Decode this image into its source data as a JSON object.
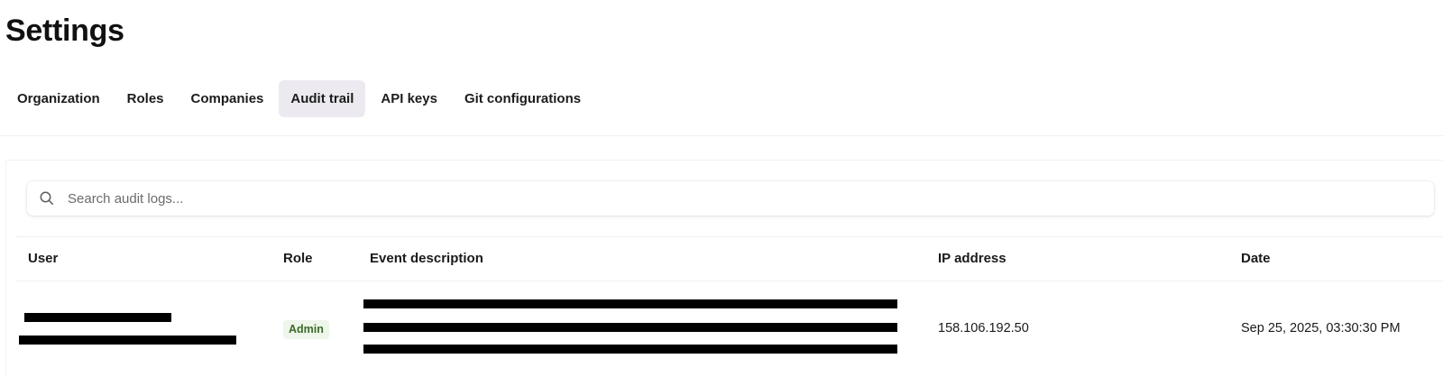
{
  "page": {
    "title": "Settings"
  },
  "tabs": [
    {
      "label": "Organization",
      "active": false
    },
    {
      "label": "Roles",
      "active": false
    },
    {
      "label": "Companies",
      "active": false
    },
    {
      "label": "Audit trail",
      "active": true
    },
    {
      "label": "API keys",
      "active": false
    },
    {
      "label": "Git configurations",
      "active": false
    }
  ],
  "search": {
    "placeholder": "Search audit logs...",
    "value": "",
    "icon": "search-icon"
  },
  "table": {
    "columns": [
      "User",
      "Role",
      "Event description",
      "IP address",
      "Date"
    ],
    "rows": [
      {
        "user": "[redacted]",
        "role": "Admin",
        "event_description": "[redacted]",
        "ip_address": "158.106.192.50",
        "date": "Sep 25, 2025, 03:30:30 PM"
      }
    ]
  },
  "colors": {
    "active_tab_bg": "#eceaf0",
    "role_badge_bg": "#eef5ea",
    "role_badge_text": "#3a6a2b",
    "redaction": "#000000"
  }
}
